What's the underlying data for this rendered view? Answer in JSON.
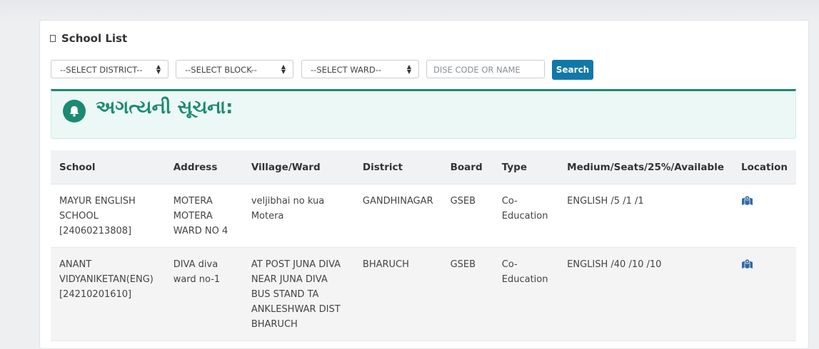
{
  "card": {
    "title": "School List"
  },
  "filters": {
    "district": "--SELECT DISTRICT--",
    "block": "--SELECT BLOCK--",
    "ward": "--SELECT WARD--",
    "search_placeholder": "DISE CODE OR NAME",
    "search_button": "Search"
  },
  "notice": {
    "text": "અગત્યની સૂચના:"
  },
  "table": {
    "headers": [
      "School",
      "Address",
      "Village/Ward",
      "District",
      "Board",
      "Type",
      "Medium/Seats/25%/Available",
      "Location"
    ],
    "rows": [
      {
        "school": "MAYUR ENGLISH SCHOOL [24060213808]",
        "address": "MOTERA MOTERA WARD NO 4",
        "village": "veljibhai no kua Motera",
        "district": "GANDHINAGAR",
        "board": "GSEB",
        "type": "Co-Education",
        "medium": "ENGLISH /5 /1 /1",
        "location_icon": "map-icon"
      },
      {
        "school": "ANANT VIDYANIKETAN(ENG) [24210201610]",
        "address": "DIVA diva ward no-1",
        "village": "AT POST JUNA DIVA NEAR JUNA DIVA BUS STAND TA ANKLESHWAR DIST BHARUCH",
        "district": "BHARUCH",
        "board": "GSEB",
        "type": "Co-Education",
        "medium": "ENGLISH /40 /10 /10",
        "location_icon": "map-icon"
      }
    ]
  },
  "colors": {
    "accent": "#1278a8",
    "notice": "#1b8a73",
    "notice_bg": "#ecf8f5"
  }
}
